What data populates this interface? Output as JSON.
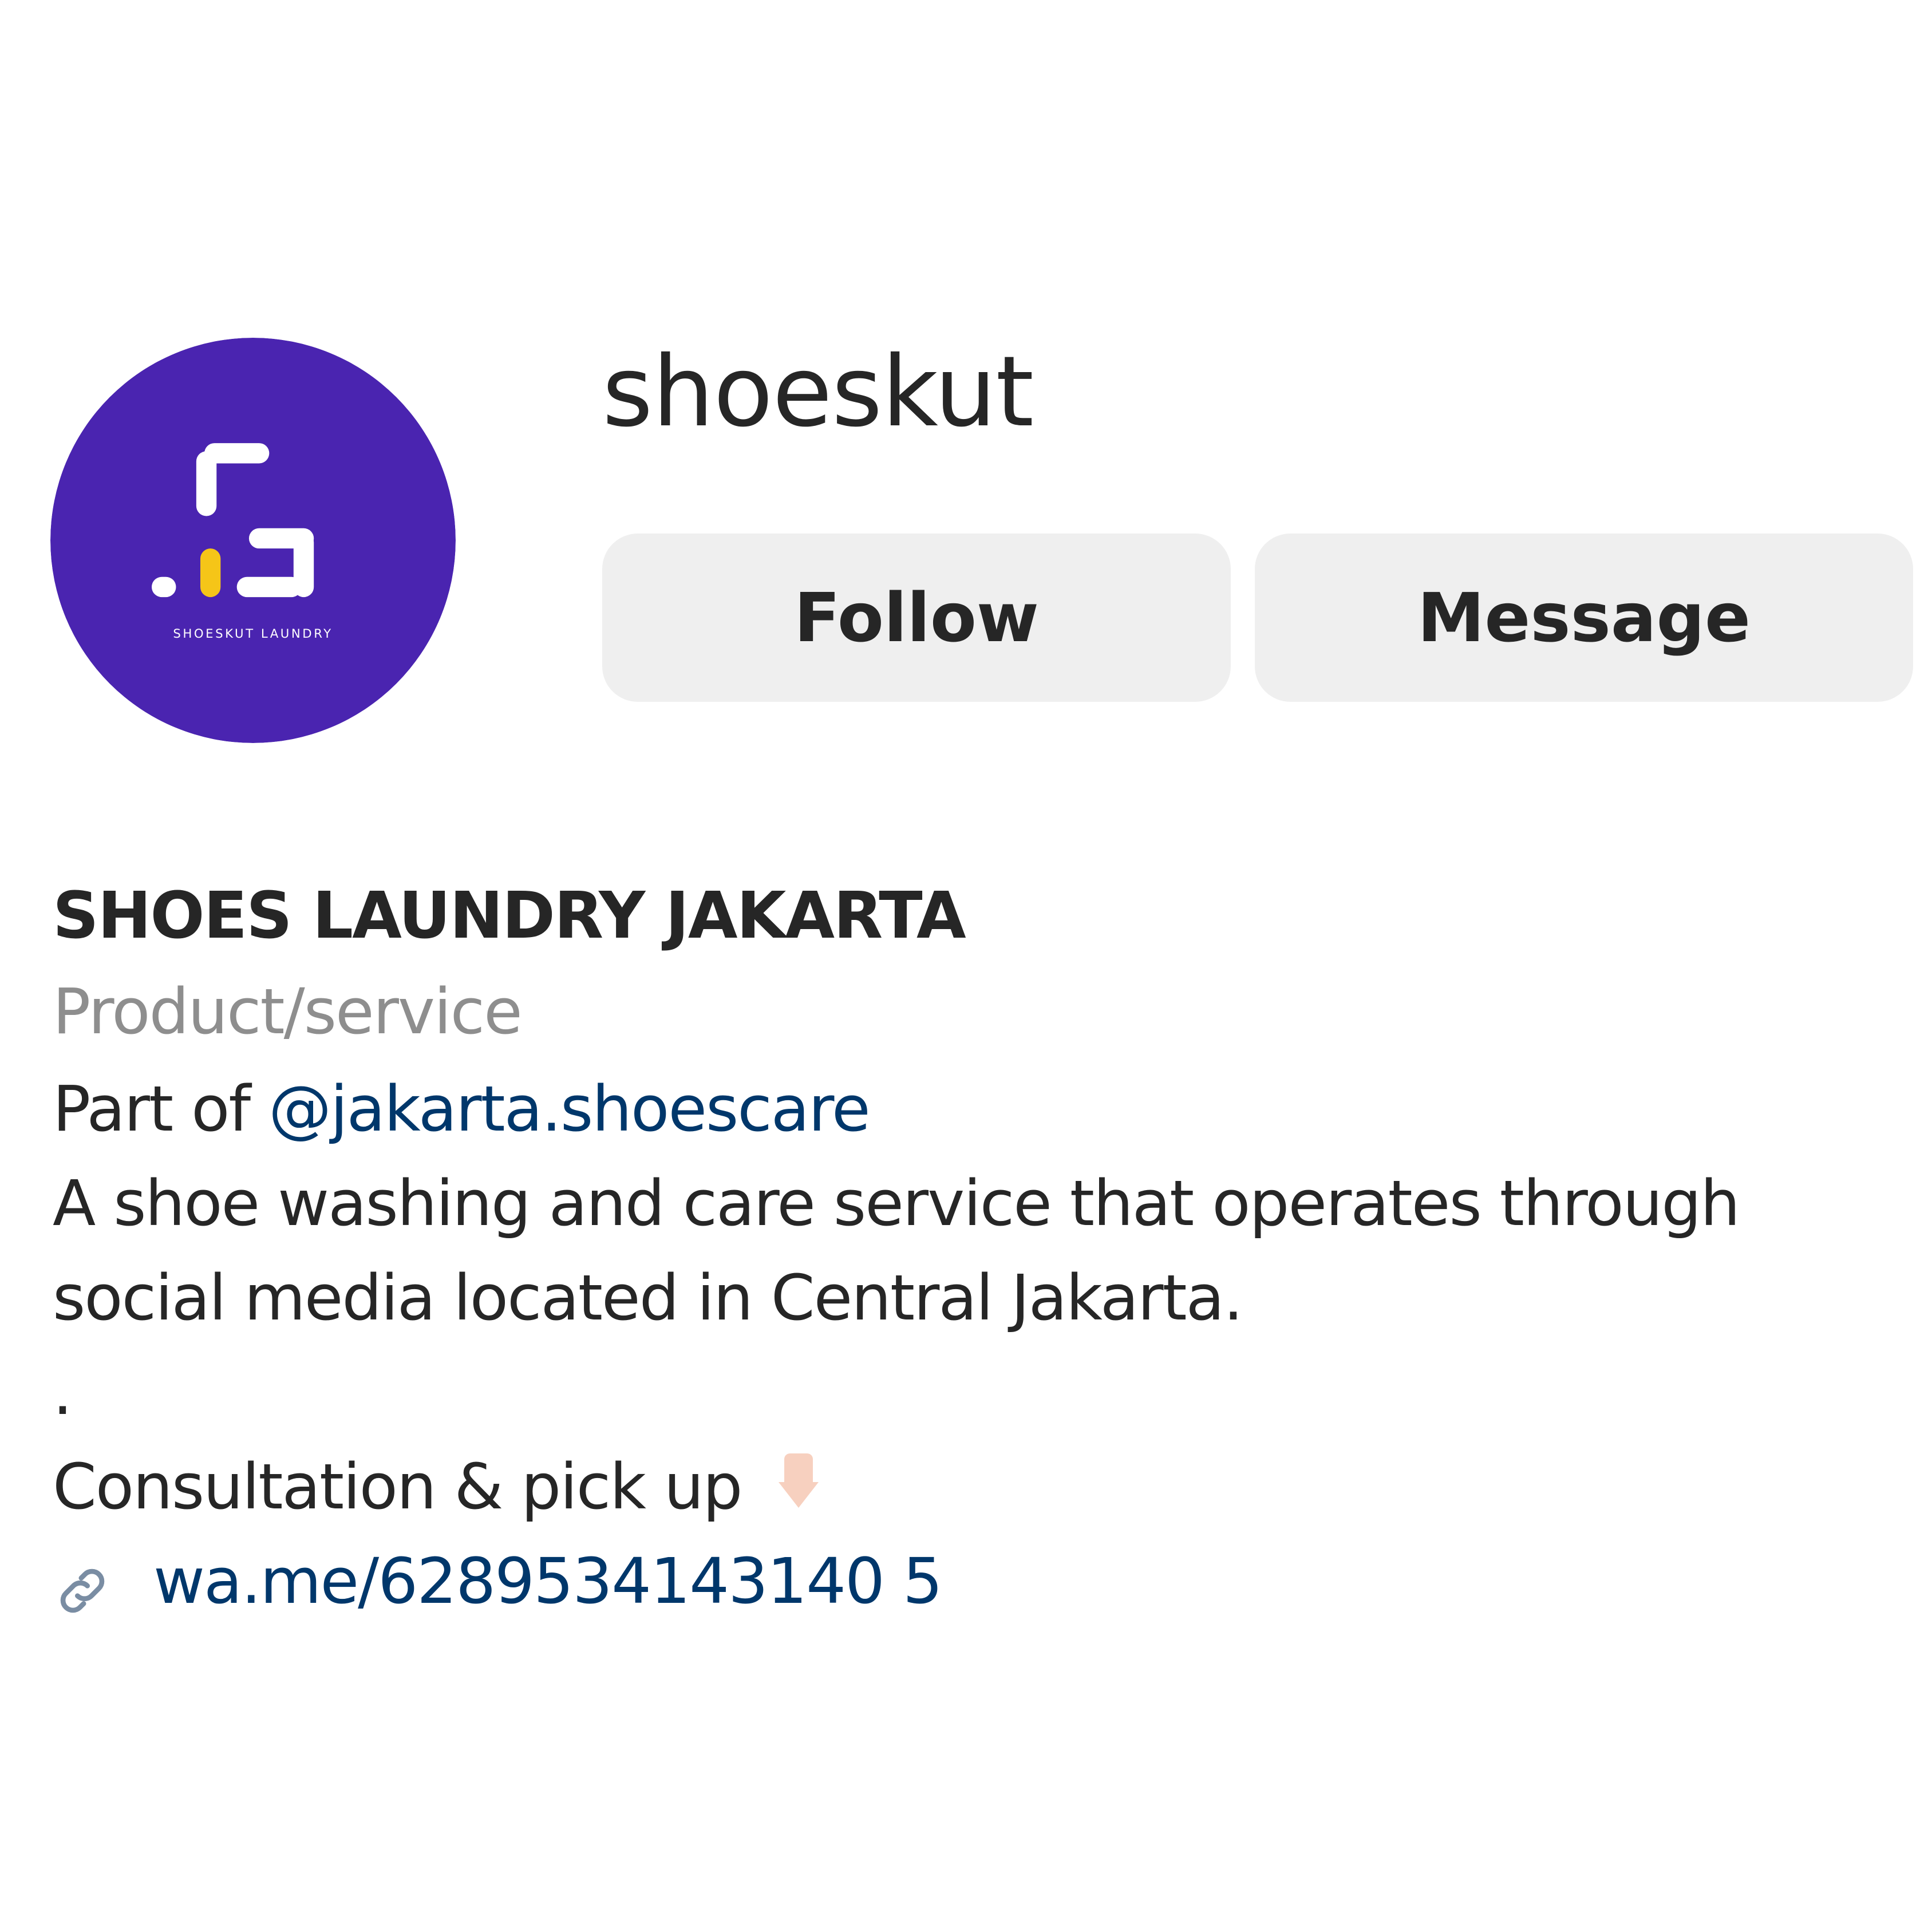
{
  "profile": {
    "username": "shoeskut",
    "avatar_label": "SHOESKUT LAUNDRY",
    "avatar_colors": {
      "background": "#4a24b0",
      "letters": "#ffffff",
      "accent": "#f5c518"
    }
  },
  "actions": {
    "follow_label": "Follow",
    "message_label": "Message"
  },
  "bio": {
    "display_name": "SHOES LAUNDRY JAKARTA",
    "category": "Product/service",
    "part_of_prefix": "Part of ",
    "part_of_handle": "@jakarta.shoescare",
    "description": "A shoe washing and care service that operates through social media located in Central Jakarta.",
    "separator": ".",
    "cta": "Consultation & pick up",
    "cta_icon": "pointing-down-hand-icon",
    "link": "wa.me/6289534143140 5"
  },
  "colors": {
    "text": "#262626",
    "secondary_text": "#8e8e8e",
    "link": "#00376b",
    "button_bg": "#efefef"
  }
}
